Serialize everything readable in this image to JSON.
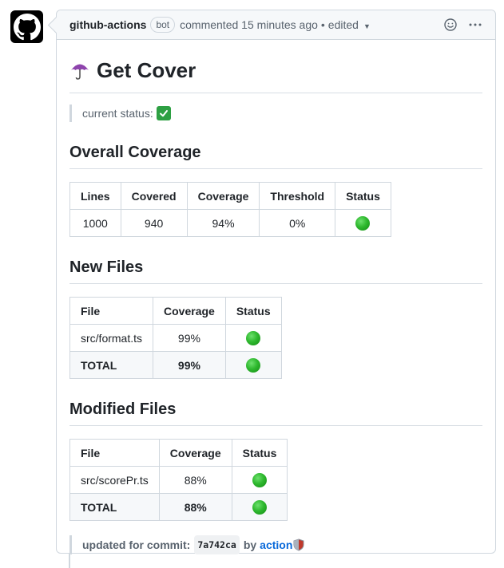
{
  "comment": {
    "author": "github-actions",
    "bot_badge": "bot",
    "action": "commented 15 minutes ago",
    "sep": "•",
    "edited": "edited"
  },
  "report": {
    "title": "Get Cover",
    "status_label": "current status:",
    "sections": {
      "overall": {
        "heading": "Overall Coverage",
        "columns": [
          "Lines",
          "Covered",
          "Coverage",
          "Threshold",
          "Status"
        ],
        "row": {
          "lines": "1000",
          "covered": "940",
          "coverage": "94%",
          "threshold": "0%",
          "status": "green"
        }
      },
      "new_files": {
        "heading": "New Files",
        "columns": [
          "File",
          "Coverage",
          "Status"
        ],
        "rows": [
          {
            "file": "src/format.ts",
            "coverage": "99%",
            "status": "green"
          }
        ],
        "total": {
          "label": "TOTAL",
          "coverage": "99%",
          "status": "green"
        }
      },
      "modified_files": {
        "heading": "Modified Files",
        "columns": [
          "File",
          "Coverage",
          "Status"
        ],
        "rows": [
          {
            "file": "src/scorePr.ts",
            "coverage": "88%",
            "status": "green"
          }
        ],
        "total": {
          "label": "TOTAL",
          "coverage": "88%",
          "status": "green"
        }
      }
    },
    "footer": {
      "prefix": "updated for commit:",
      "sha": "7a742ca",
      "by": "by",
      "link": "action"
    }
  },
  "colors": {
    "link": "#0969da",
    "status_green": "#2fb92f",
    "border": "#d0d7de"
  },
  "icons": [
    "github-logo-icon",
    "smiley-icon",
    "kebab-icon",
    "umbrella-icon",
    "check-mark-icon",
    "shield-icon"
  ]
}
